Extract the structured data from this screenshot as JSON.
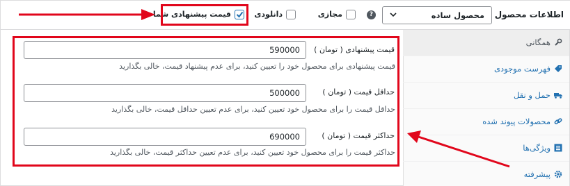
{
  "header": {
    "title": "اطلاعات محصول —",
    "product_type": "محصول ساده",
    "help": "?",
    "checkboxes": [
      {
        "label": "مجازی",
        "checked": false
      },
      {
        "label": "دانلودی",
        "checked": false
      },
      {
        "label": "قیمت پیشنهادی شما",
        "checked": true
      }
    ]
  },
  "sidebar": {
    "items": [
      {
        "label": "همگانی",
        "icon": "wrench-icon",
        "active": true
      },
      {
        "label": "فهرست موجودی",
        "icon": "tag-icon",
        "active": false
      },
      {
        "label": "حمل و نقل",
        "icon": "truck-icon",
        "active": false
      },
      {
        "label": "محصولات پیوند شده",
        "icon": "link-icon",
        "active": false
      },
      {
        "label": "ویژگی‌ها",
        "icon": "list-icon",
        "active": false
      },
      {
        "label": "پیشرفته",
        "icon": "gear-icon",
        "active": false
      }
    ]
  },
  "fields": [
    {
      "label": "قیمت پیشنهادی ( تومان )",
      "value": "590000",
      "description": "قیمت پیشنهادی برای محصول خود را تعیین کنید، برای عدم پیشنهاد قیمت، خالی بگذارید"
    },
    {
      "label": "حداقل قیمت ( تومان )",
      "value": "500000",
      "description": "حداقل قیمت را برای محصول خود تعیین کنید، برای عدم تعیین حداقل قیمت، خالی بگذارید"
    },
    {
      "label": "حداکثر قیمت ( تومان )",
      "value": "690000",
      "description": "حداکثر قیمت را برای محصول خود تعیین کنید، برای عدم تعیین حداکثر قیمت، خالی بگذارید"
    }
  ],
  "colors": {
    "highlight": "#e1061b",
    "accent": "#2271b1"
  }
}
